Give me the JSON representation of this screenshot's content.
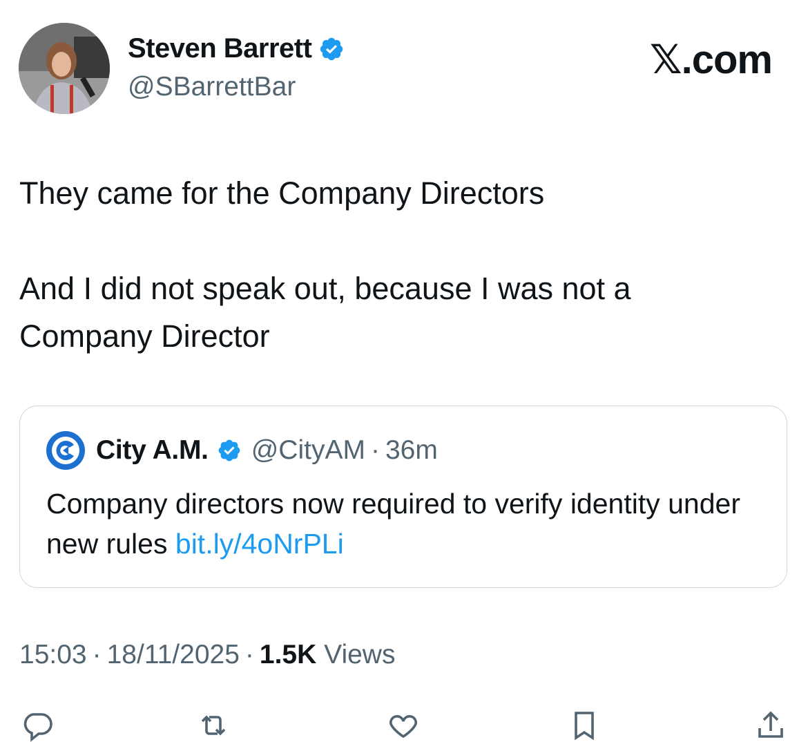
{
  "author": {
    "display_name": "Steven Barrett",
    "handle": "@SBarrettBar",
    "verified": true,
    "avatar": "avatar-photo"
  },
  "brand": {
    "label": "𝕏.com"
  },
  "tweet": {
    "line1": "They came for the Company Directors",
    "line2": "And I did not speak out, because I was not a",
    "line3": "Company Director"
  },
  "quoted": {
    "logo": "city-am-logo",
    "display_name": "City A.M.",
    "verified": true,
    "handle": "@CityAM",
    "separator": "·",
    "time": "36m",
    "text": "Company directors now required to verify identity under new rules",
    "link": "bit.ly/4oNrPLi"
  },
  "meta": {
    "time": "15:03",
    "separator": "·",
    "date": "18/11/2025",
    "views_count": "1.5K",
    "views_label": "Views"
  },
  "actions": [
    {
      "icon": "reply-icon"
    },
    {
      "icon": "retweet-icon"
    },
    {
      "icon": "like-icon"
    },
    {
      "icon": "bookmark-icon"
    },
    {
      "icon": "share-icon"
    }
  ],
  "colors": {
    "text": "#0f1419",
    "secondary": "#536471",
    "link": "#1d9bf0",
    "verified": "#1d9bf0",
    "border": "#cfd9de"
  }
}
